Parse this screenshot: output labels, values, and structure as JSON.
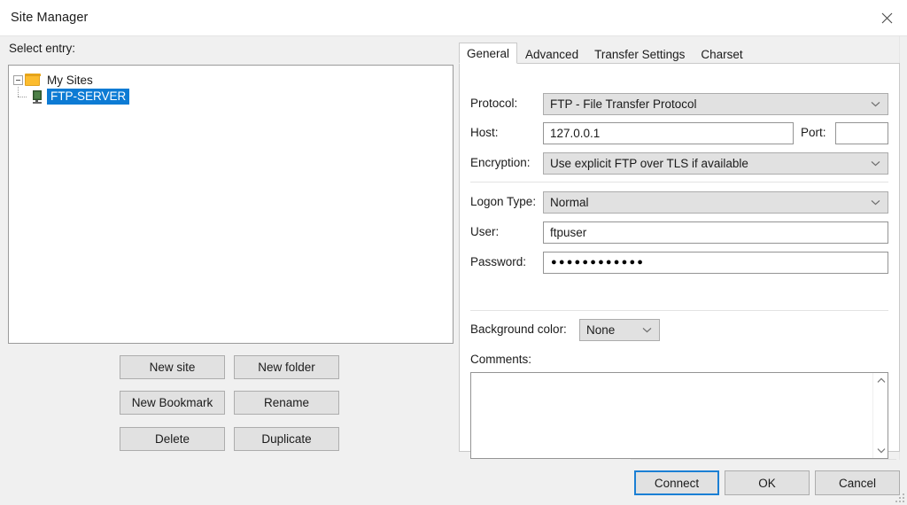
{
  "window": {
    "title": "Site Manager",
    "close_icon": "close-icon"
  },
  "left_pane": {
    "select_entry_label": "Select entry:",
    "tree": {
      "root": {
        "label": "My Sites",
        "icon": "folder-icon",
        "expanded": true,
        "expander_glyph": "−"
      },
      "children": [
        {
          "label": "FTP-SERVER",
          "icon": "server-icon",
          "selected": true,
          "selection_color": "#0d7bd4"
        }
      ]
    },
    "buttons": [
      {
        "label": "New site"
      },
      {
        "label": "New folder"
      },
      {
        "label": "New Bookmark"
      },
      {
        "label": "Rename"
      },
      {
        "label": "Delete"
      },
      {
        "label": "Duplicate"
      }
    ]
  },
  "right_pane": {
    "tabs": [
      {
        "label": "General",
        "active": true
      },
      {
        "label": "Advanced",
        "active": false
      },
      {
        "label": "Transfer Settings",
        "active": false
      },
      {
        "label": "Charset",
        "active": false
      }
    ],
    "general": {
      "protocol": {
        "label": "Protocol:",
        "value": "FTP - File Transfer Protocol",
        "chevron": "chevron-down-icon"
      },
      "host": {
        "label": "Host:",
        "value": "127.0.0.1",
        "placeholder": ""
      },
      "port": {
        "label": "Port:",
        "value": "",
        "placeholder": ""
      },
      "encryption": {
        "label": "Encryption:",
        "value": "Use explicit FTP over TLS if available",
        "chevron": "chevron-down-icon"
      },
      "logon_type": {
        "label": "Logon Type:",
        "value": "Normal",
        "chevron": "chevron-down-icon"
      },
      "user": {
        "label": "User:",
        "value": "ftpuser",
        "placeholder": ""
      },
      "password": {
        "label": "Password:",
        "value": "●●●●●●●●●●●●",
        "masked": true,
        "placeholder": ""
      },
      "background_color": {
        "label": "Background color:",
        "value": "None",
        "chevron": "chevron-down-icon"
      },
      "comments": {
        "label": "Comments:",
        "value": "",
        "placeholder": ""
      }
    }
  },
  "footer": {
    "buttons": [
      {
        "label": "Connect",
        "default": true,
        "focus_color": "#1b7fd4"
      },
      {
        "label": "OK",
        "default": false
      },
      {
        "label": "Cancel",
        "default": false
      }
    ],
    "resize_grip": "resize-grip-icon"
  }
}
